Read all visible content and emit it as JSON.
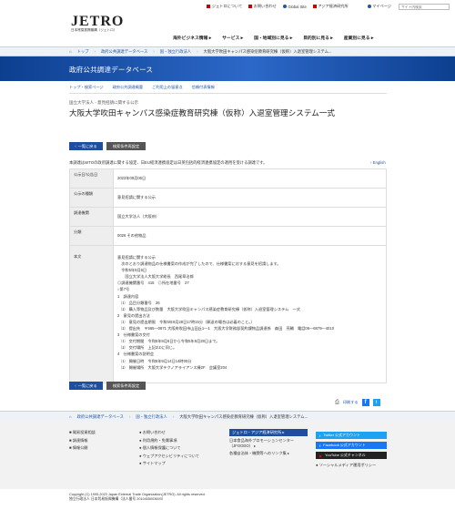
{
  "topbar": {
    "links": [
      "ジェトロについて",
      "お問い合わせ",
      "Global Site",
      "アジア経済研究所"
    ],
    "mypage": "マイページ",
    "search_placeholder": "サイト内検索"
  },
  "logo": {
    "brand": "JETRO",
    "sub": "日本貿易振興機構（ジェトロ）"
  },
  "gnav": [
    "海外ビジネス情報 ▸",
    "サービス ▸",
    "国・地域別に見る ▸",
    "目的別に見る ▸",
    "産業別に見る ▸"
  ],
  "breadcrumb": [
    "トップ",
    "政府公共調達データベース",
    "国・独立行政法人",
    "大阪大学吹田キャンパス感染症教育研究棟（仮称）入退室管理システム..."
  ],
  "banner_title": "政府公共調達データベース",
  "subnav": [
    "トップ・検索ページ",
    "政府公共調達概要",
    "ご利用上の留意点",
    "信頼付表情報"
  ],
  "category": "国立大学法人 - 意見招請に関する公示",
  "title": "大阪大学吹田キャンパス感染症教育研究棟（仮称）入退室管理システム一式",
  "buttons": {
    "back": "一覧に戻る",
    "print": "検索条件再設定"
  },
  "note": "本調達はWTOの政府調達に関する協定、日EU経済連携協定は日英包括的経済連携協定の適用を受ける調達です。",
  "english": "English",
  "table": [
    {
      "label": "公示日/公告日",
      "value": "2023年09月06日"
    },
    {
      "label": "公示の種類",
      "value": "意見招請に関する公示"
    },
    {
      "label": "調達機関",
      "value": "国立大学法人（大阪府）"
    },
    {
      "label": "分類",
      "value": "0026 その他物品"
    }
  ],
  "body_label": "本文",
  "body_lines": [
    "意見招請に関する公示",
    "　次のとおり調達物品の仕様書案の作成が完了したので、仕様書案に対する意見を招請します。",
    "　令和5年9月6日",
    "　　国立大学法人大阪大学総長　西尾章治郎",
    "◎調達機関番号　415　◎所在地番号　27",
    "○第7号",
    "1　調達内容",
    "　⑴　品目分類番号　26",
    "　⑵　購入等物品及び数量　大阪大学吹田キャンパス感染症教育研究棟（仮称）入退室管理システム　一式",
    "2　意見の提出方法",
    "　⑴　意見の提出期限　令和5年9月28日17時15分（郵送の場合は必着のこと。）",
    "　⑵　提出先　〒565—0871 大阪府吹田市山田丘1—1　大阪大学財務部契約課物品調達係　森田　亮輔　電話06—6879—4010",
    "3　仕様書案の交付",
    "　⑴　交付期間　令和5年9月6日から令和5年9月28日まで。",
    "　⑵　交付場所　上記2⑵に同じ。",
    "4　仕様書案の説明会",
    "　⑴　開催日時　令和5年9月14日14時00分",
    "　⑵　開催場所　大阪大学テクノアライアンス棟2F　会議室204"
  ],
  "share": {
    "print_label": "印刷する",
    "fb": "f",
    "tw": "t"
  },
  "footer": {
    "col1": [
      "貿易投資相談",
      "調達情報",
      "情報公開"
    ],
    "col2": [
      "お問い合わせ",
      "利用規約・免責事項",
      "個人情報保護について",
      "ウェブアクセシビリティについて",
      "サイトマップ"
    ],
    "col3": [
      "ジェトロ・アジア経済研究所 ▸",
      "日本食品海外プロモーションセンター（JFOODO） ▸",
      "各種自治体・機関等へのリンク集 ▸"
    ],
    "sns": [
      "Twitter 公式アカウント",
      "Facebook 公式アカウント",
      "YouTube 公式チャンネル",
      "ソーシャルメディア運用ポリシー"
    ]
  },
  "copyright": [
    "Copyright (C) 1995-2023 Japan External Trade Organization(JETRO). All rights reserved.",
    "独立行政法人 日本貿易振興機構（法人番号 2010405003693）"
  ],
  "colors": {
    "accent": "#1e4f9e",
    "banner": "#2c68c8",
    "link": "#2155a6",
    "brand_red": "#cc0000"
  }
}
